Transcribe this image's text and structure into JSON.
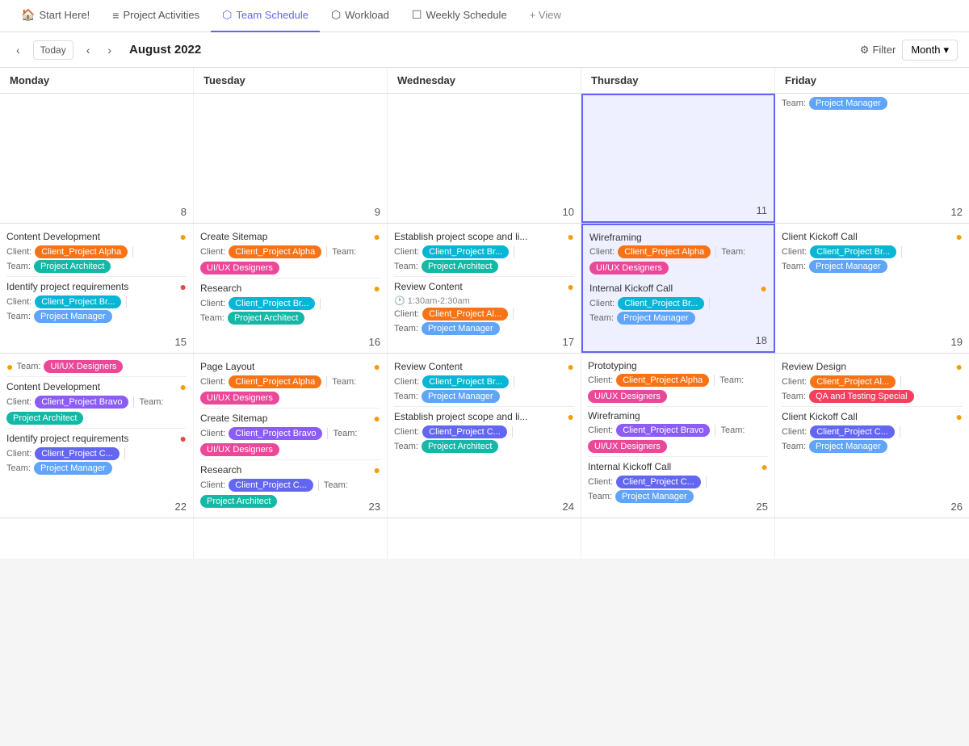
{
  "nav": {
    "tabs": [
      {
        "id": "start",
        "label": "Start Here!",
        "icon": "🏠",
        "active": false
      },
      {
        "id": "activities",
        "label": "Project Activities",
        "icon": "≡",
        "active": false
      },
      {
        "id": "team",
        "label": "Team Schedule",
        "icon": "⬡",
        "active": true
      },
      {
        "id": "workload",
        "label": "Workload",
        "icon": "⬡",
        "active": false
      },
      {
        "id": "weekly",
        "label": "Weekly Schedule",
        "icon": "☐",
        "active": false
      },
      {
        "id": "view",
        "label": "+ View",
        "icon": "",
        "active": false
      }
    ]
  },
  "toolbar": {
    "today": "Today",
    "title": "August 2022",
    "filter": "Filter",
    "view": "Month"
  },
  "days": [
    "Monday",
    "Tuesday",
    "Wednesday",
    "Thursday",
    "Friday"
  ],
  "weeks": [
    {
      "cells": [
        {
          "day": "mon",
          "number": "8",
          "highlighted": false,
          "events": []
        },
        {
          "day": "tue",
          "number": "9",
          "highlighted": false,
          "events": []
        },
        {
          "day": "wed",
          "number": "10",
          "highlighted": false,
          "events": []
        },
        {
          "day": "thu",
          "number": "11",
          "highlighted": true,
          "events": []
        },
        {
          "day": "fri",
          "number": "12",
          "highlighted": false,
          "events": [
            {
              "title": "",
              "partial": true,
              "client_tag": "Project Manager",
              "client_color": "tag-blue-light",
              "label_type": "team"
            }
          ]
        }
      ]
    },
    {
      "cells": [
        {
          "day": "mon",
          "number": "15",
          "highlighted": false,
          "events": [
            {
              "title": "Content Development",
              "dot": "yellow",
              "client_label": "Client:",
              "client_tag": "Client_Project Alpha",
              "client_color": "tag-orange",
              "team_label": "Team:",
              "team_tag": "Project Architect",
              "team_color": "tag-teal"
            },
            {
              "separator": true
            },
            {
              "title": "Identify project requirements",
              "dot": "red",
              "client_label": "Client:",
              "client_tag": "Client_Project Br...",
              "client_color": "tag-cyan",
              "team_label": "Team:",
              "team_tag": "Project Manager",
              "team_color": "tag-blue-light"
            }
          ]
        },
        {
          "day": "tue",
          "number": "16",
          "highlighted": false,
          "events": [
            {
              "title": "Create Sitemap",
              "dot": "yellow",
              "client_label": "Client:",
              "client_tag": "Client_Project Alpha",
              "client_color": "tag-orange",
              "team_label": "Team:",
              "team_tag": "UI/UX Designers",
              "team_color": "tag-pink"
            },
            {
              "separator": true
            },
            {
              "title": "Research",
              "dot": "yellow",
              "client_label": "Client:",
              "client_tag": "Client_Project Br...",
              "client_color": "tag-cyan",
              "team_label": "Team:",
              "team_tag": "Project Architect",
              "team_color": "tag-teal"
            }
          ]
        },
        {
          "day": "wed",
          "number": "17",
          "highlighted": false,
          "events": [
            {
              "title": "Establish project scope and li...",
              "dot": "yellow",
              "client_label": "Client:",
              "client_tag": "Client_Project Br...",
              "client_color": "tag-cyan",
              "team_label": "Team:",
              "team_tag": "Project Architect",
              "team_color": "tag-teal"
            },
            {
              "separator": true
            },
            {
              "title": "Review Content",
              "dot": "yellow",
              "time": "1:30am-2:30am",
              "client_label": "Client:",
              "client_tag": "Client_Project Al...",
              "client_color": "tag-orange",
              "team_label": "Team:",
              "team_tag": "Project Manager",
              "team_color": "tag-blue-light"
            }
          ]
        },
        {
          "day": "thu",
          "number": "18",
          "highlighted": true,
          "events": [
            {
              "title": "Wireframing",
              "dot": "none",
              "client_label": "Client:",
              "client_tag": "Client_Project Alpha",
              "client_color": "tag-orange",
              "team_label": "Team:",
              "team_tag": "UI/UX Designers",
              "team_color": "tag-pink"
            },
            {
              "separator": true
            },
            {
              "title": "Internal Kickoff Call",
              "dot": "yellow",
              "client_label": "Client:",
              "client_tag": "Client_Project Br...",
              "client_color": "tag-cyan",
              "team_label": "Team:",
              "team_tag": "Project Manager",
              "team_color": "tag-blue-light"
            }
          ]
        },
        {
          "day": "fri",
          "number": "19",
          "highlighted": false,
          "events": [
            {
              "title": "Client Kickoff Call",
              "dot": "yellow",
              "client_label": "Client:",
              "client_tag": "Client_Project Br...",
              "client_color": "tag-cyan",
              "team_label": "Team:",
              "team_tag": "Project Manager",
              "team_color": "tag-blue-light"
            }
          ]
        }
      ]
    },
    {
      "cells": [
        {
          "day": "mon",
          "number": "22",
          "highlighted": false,
          "events": [
            {
              "title": "",
              "partial_team": true,
              "team_label": "Team:",
              "team_tag": "UI/UX Designers",
              "team_color": "tag-pink",
              "dot": "yellow"
            },
            {
              "separator": true
            },
            {
              "title": "Content Development",
              "dot": "yellow",
              "client_label": "Client:",
              "client_tag": "Client_Project Bravo",
              "client_color": "tag-purple",
              "team_label": "Team:",
              "team_tag": "Project Architect",
              "team_color": "tag-teal"
            },
            {
              "separator": true
            },
            {
              "title": "Identify project requirements",
              "dot": "red",
              "client_label": "Client:",
              "client_tag": "Client_Project C...",
              "client_color": "tag-indigo",
              "team_label": "Team:",
              "team_tag": "Project Manager",
              "team_color": "tag-blue-light"
            }
          ]
        },
        {
          "day": "tue",
          "number": "23",
          "highlighted": false,
          "events": [
            {
              "title": "Page Layout",
              "dot": "yellow",
              "client_label": "Client:",
              "client_tag": "Client_Project Alpha",
              "client_color": "tag-orange",
              "team_label": "Team:",
              "team_tag": "UI/UX Designers",
              "team_color": "tag-pink"
            },
            {
              "separator": true
            },
            {
              "title": "Create Sitemap",
              "dot": "yellow",
              "client_label": "Client:",
              "client_tag": "Client_Project Bravo",
              "client_color": "tag-purple",
              "team_label": "Team:",
              "team_tag": "UI/UX Designers",
              "team_color": "tag-pink"
            },
            {
              "separator": true
            },
            {
              "title": "Research",
              "dot": "yellow",
              "client_label": "Client:",
              "client_tag": "Client_Project C...",
              "client_color": "tag-indigo",
              "team_label": "Team:",
              "team_tag": "Project Architect",
              "team_color": "tag-teal"
            }
          ]
        },
        {
          "day": "wed",
          "number": "24",
          "highlighted": false,
          "events": [
            {
              "title": "Review Content",
              "dot": "yellow",
              "client_label": "Client:",
              "client_tag": "Client_Project Br...",
              "client_color": "tag-cyan",
              "team_label": "Team:",
              "team_tag": "Project Manager",
              "team_color": "tag-blue-light"
            },
            {
              "separator": true
            },
            {
              "title": "Establish project scope and li...",
              "dot": "yellow",
              "client_label": "Client:",
              "client_tag": "Client_Project C...",
              "client_color": "tag-indigo",
              "team_label": "Team:",
              "team_tag": "Project Architect",
              "team_color": "tag-teal"
            }
          ]
        },
        {
          "day": "thu",
          "number": "25",
          "highlighted": false,
          "events": [
            {
              "title": "Prototyping",
              "dot": "none",
              "client_label": "Client:",
              "client_tag": "Client_Project Alpha",
              "client_color": "tag-orange",
              "team_label": "Team:",
              "team_tag": "UI/UX Designers",
              "team_color": "tag-pink"
            },
            {
              "separator": true
            },
            {
              "title": "Wireframing",
              "dot": "none",
              "client_label": "Client:",
              "client_tag": "Client_Project Bravo",
              "client_color": "tag-purple",
              "team_label": "Team:",
              "team_tag": "UI/UX Designers",
              "team_color": "tag-pink"
            },
            {
              "separator": true
            },
            {
              "title": "Internal Kickoff Call",
              "dot": "yellow",
              "client_label": "Client:",
              "client_tag": "Client_Project C...",
              "client_color": "tag-indigo",
              "team_label": "Team:",
              "team_tag": "Project Manager",
              "team_color": "tag-blue-light"
            }
          ]
        },
        {
          "day": "fri",
          "number": "26",
          "highlighted": false,
          "events": [
            {
              "title": "Review Design",
              "dot": "yellow",
              "client_label": "Client:",
              "client_tag": "Client_Project Al...",
              "client_color": "tag-orange",
              "team_label": "Team:",
              "team_tag": "QA and Testing Special",
              "team_color": "tag-rose"
            },
            {
              "separator": true
            },
            {
              "title": "Client Kickoff Call",
              "dot": "yellow",
              "client_label": "Client:",
              "client_tag": "Client_Project C...",
              "client_color": "tag-indigo",
              "team_label": "Team:",
              "team_tag": "Project Manager",
              "team_color": "tag-blue-light"
            }
          ]
        }
      ]
    }
  ]
}
